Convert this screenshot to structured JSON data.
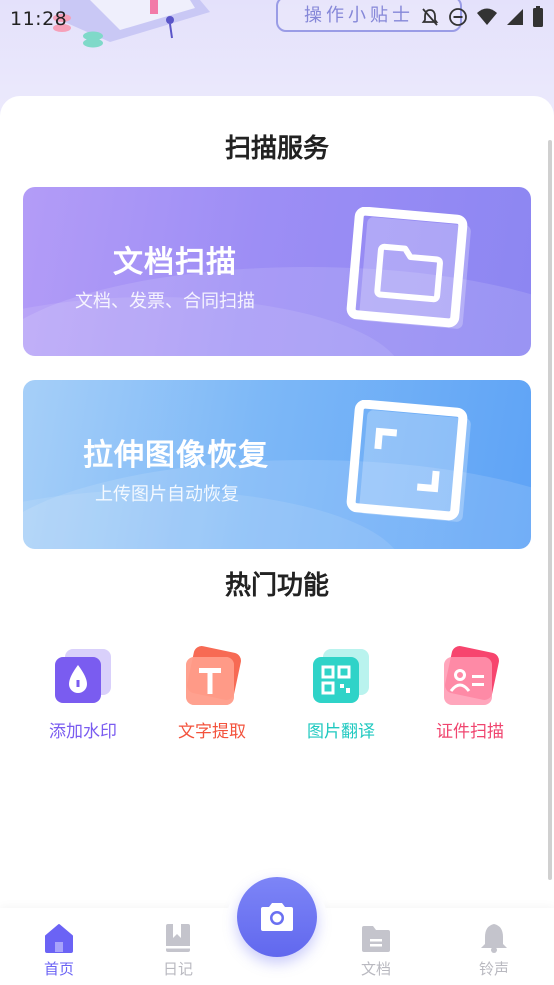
{
  "status_bar": {
    "time": "11:28",
    "icons": [
      "notifications-off-icon",
      "do-not-disturb-icon",
      "wifi-icon",
      "signal-icon",
      "battery-icon"
    ]
  },
  "tips_label": "操作小贴士",
  "sections": {
    "scan_title": "扫描服务",
    "hot_title": "热门功能"
  },
  "banners": [
    {
      "title": "文档扫描",
      "subtitle": "文档、发票、合同扫描",
      "icon": "folder-icon"
    },
    {
      "title": "拉伸图像恢复",
      "subtitle": "上传图片自动恢复",
      "icon": "crop-frame-icon"
    }
  ],
  "features": [
    {
      "label": "添加水印",
      "icon": "watermark-drop-icon",
      "color": "#7a5cf0"
    },
    {
      "label": "文字提取",
      "icon": "text-t-icon",
      "color": "#f3533d"
    },
    {
      "label": "图片翻译",
      "icon": "qr-code-icon",
      "color": "#20c9c0"
    },
    {
      "label": "证件扫描",
      "icon": "id-card-icon",
      "color": "#f0456f"
    }
  ],
  "bottom_nav": [
    {
      "label": "首页",
      "icon": "home-icon",
      "active": true
    },
    {
      "label": "日记",
      "icon": "book-icon",
      "active": false
    },
    {
      "label": "文档",
      "icon": "folder-doc-icon",
      "active": false
    },
    {
      "label": "铃声",
      "icon": "bell-icon",
      "active": false
    }
  ],
  "camera_button": {
    "icon": "camera-icon"
  },
  "colors": {
    "accent": "#6b63f5",
    "inactive": "#b9b9c0"
  }
}
